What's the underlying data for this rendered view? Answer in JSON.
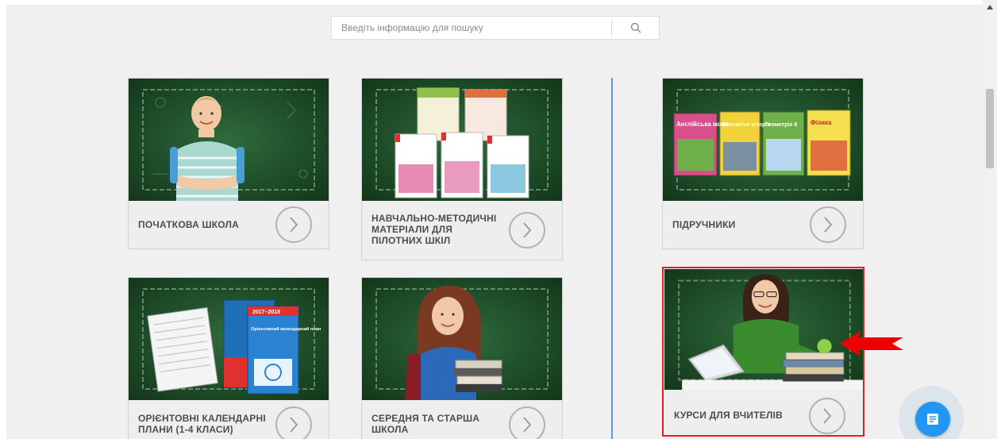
{
  "search": {
    "placeholder": "Введіть інформацію для пошуку",
    "icon": "search-icon"
  },
  "cards": [
    {
      "label": "ПОЧАТКОВА ШКОЛА",
      "image": "schoolboy-image"
    },
    {
      "label": "НАВЧАЛЬНО-МЕТОДИЧНІ МАТЕРІАЛИ ДЛЯ ПІЛОТНИХ ШКІЛ",
      "image": "methodical-books-image"
    },
    {
      "label": "ПІДРУЧНИКИ",
      "image": "textbooks-image",
      "book_titles": [
        "Англійська мова",
        "Всесвітня історія",
        "Геометрія 8",
        "Фізика"
      ]
    },
    {
      "label": "ОРІЄНТОВНІ КАЛЕНДАРНІ ПЛАНИ (1-4 КЛАСИ)",
      "image": "calendar-plans-image",
      "cover_text": [
        "Орієнтовний календарний план",
        "2017–2018"
      ]
    },
    {
      "label": "СЕРЕДНЯ ТА СТАРША ШКОЛА",
      "image": "student-girl-image"
    },
    {
      "label": "КУРСИ ДЛЯ ВЧИТЕЛІВ",
      "image": "teacher-laptop-image",
      "highlighted": true
    }
  ],
  "colors": {
    "chalkboard": "#1f4e2a",
    "divider": "#5b9bd5",
    "highlight": "#e02020",
    "chat_button": "#2196f3"
  },
  "chat": {
    "icon": "chat-icon"
  }
}
